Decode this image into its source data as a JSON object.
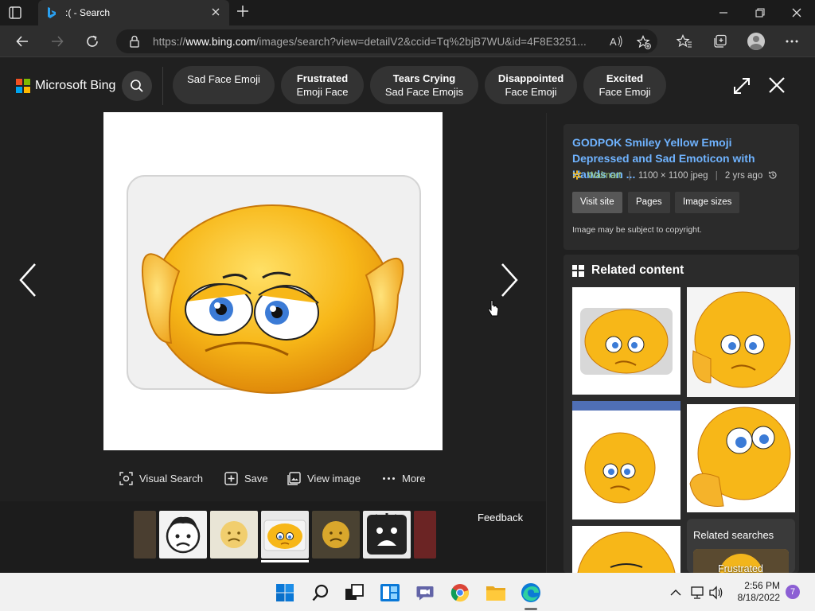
{
  "browser": {
    "tab_title": ":( - Search",
    "url_prefix": "https://",
    "url_domain": "www.bing.com",
    "url_path": "/images/search?view=detailV2&ccid=Tq%2bjB7WU&id=4F8E3251...",
    "icons": [
      "tab-actions-icon",
      "bing-favicon",
      "close-icon",
      "plus-icon",
      "minimize-icon",
      "restore-icon",
      "close-window-icon",
      "back-arrow-icon",
      "forward-arrow-icon",
      "refresh-icon",
      "lock-icon",
      "read-aloud-icon",
      "add-favorite-icon",
      "favorites-icon",
      "collections-icon",
      "profile-icon",
      "more-icon"
    ]
  },
  "bing": {
    "brand": "Microsoft Bing",
    "chips": [
      {
        "line1": "Sad Face Emoji",
        "line2": ""
      },
      {
        "line1": "Frustrated",
        "line2": "Emoji Face"
      },
      {
        "line1": "Tears Crying",
        "line2": "Sad Face Emojis"
      },
      {
        "line1": "Disappointed",
        "line2": "Face Emoji"
      },
      {
        "line1": "Excited",
        "line2": "Face Emoji"
      }
    ]
  },
  "viewer": {
    "actions": {
      "visual_search": "Visual Search",
      "save": "Save",
      "view_image": "View image",
      "more": "More"
    },
    "feedback": "Feedback"
  },
  "details": {
    "title": "GODPOK Smiley Yellow Emoji Depressed and Sad Emoticon with Hands on ...",
    "source": "Walmart",
    "dimensions": "1100 × 1100 jpeg",
    "age": "2 yrs ago",
    "buttons": {
      "visit": "Visit site",
      "pages": "Pages",
      "sizes": "Image sizes"
    },
    "copyright": "Image may be subject to copyright."
  },
  "related": {
    "title": "Related content",
    "searches_label": "Related searches",
    "search_chip": "Frustrated"
  },
  "taskbar": {
    "time": "2:56 PM",
    "date": "8/18/2022",
    "notifications": "7"
  },
  "colors": {
    "accent_link": "#6fb3ff",
    "source_green": "#9fcf7a",
    "emoji_yellow": "#f5b512"
  }
}
